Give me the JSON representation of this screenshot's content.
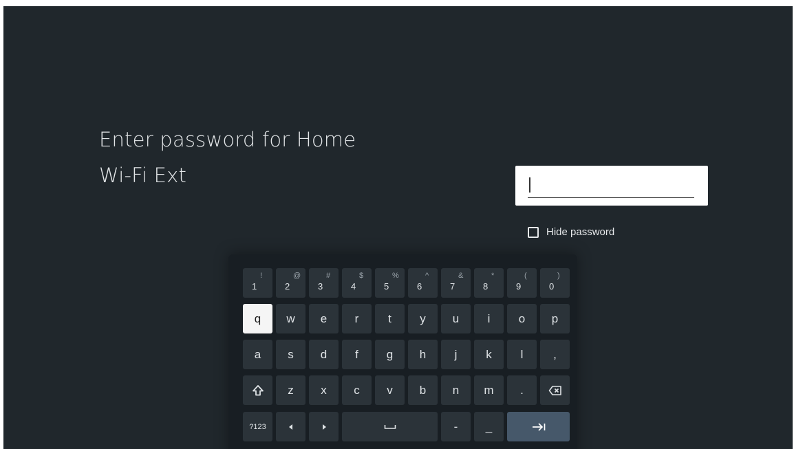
{
  "title": {
    "line1": "Enter password for Home",
    "line2": "Wi-Fi Ext"
  },
  "password": {
    "value": "",
    "placeholder": ""
  },
  "hide_password": {
    "label": "Hide password",
    "checked": false
  },
  "keyboard": {
    "number_row": [
      {
        "main": "1",
        "alt": "!"
      },
      {
        "main": "2",
        "alt": "@"
      },
      {
        "main": "3",
        "alt": "#"
      },
      {
        "main": "4",
        "alt": "$"
      },
      {
        "main": "5",
        "alt": "%"
      },
      {
        "main": "6",
        "alt": "^"
      },
      {
        "main": "7",
        "alt": "&"
      },
      {
        "main": "8",
        "alt": "*"
      },
      {
        "main": "9",
        "alt": "("
      },
      {
        "main": "0",
        "alt": ")"
      }
    ],
    "row1": [
      "q",
      "w",
      "e",
      "r",
      "t",
      "y",
      "u",
      "i",
      "o",
      "p"
    ],
    "row2": [
      "a",
      "s",
      "d",
      "f",
      "g",
      "h",
      "j",
      "k",
      "l",
      ","
    ],
    "row3": [
      "z",
      "x",
      "c",
      "v",
      "b",
      "n",
      "m",
      "."
    ],
    "symbols_key": "?123",
    "dash_key": "-",
    "underscore_key": "_",
    "focused_key": "q",
    "icons": {
      "shift": "shift-icon",
      "backspace": "backspace-icon",
      "left": "arrow-left-icon",
      "right": "arrow-right-icon",
      "space": "space-icon",
      "next": "tab-next-icon"
    },
    "accent_color": "#46586a"
  }
}
